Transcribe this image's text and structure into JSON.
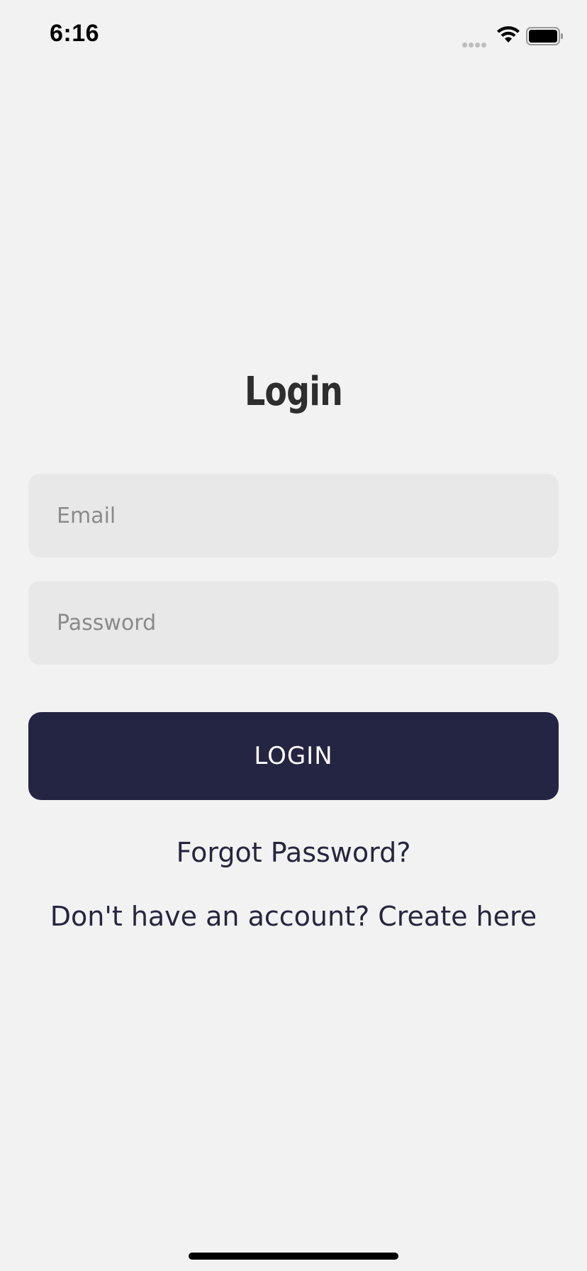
{
  "status_bar": {
    "time": "6:16",
    "icons": [
      "signal-icon",
      "wifi-icon",
      "battery-icon"
    ]
  },
  "login": {
    "title": "Login",
    "email_placeholder": "Email",
    "email_value": "",
    "password_placeholder": "Password",
    "password_value": "",
    "button_label": "LOGIN",
    "forgot_password": "Forgot Password?",
    "create_account": "Don't have an account? Create here"
  },
  "colors": {
    "background": "#f2f2f2",
    "field_background": "#e8e8e8",
    "button_background": "#242443",
    "link_color": "#262640",
    "title_color": "#2e2e2e"
  }
}
